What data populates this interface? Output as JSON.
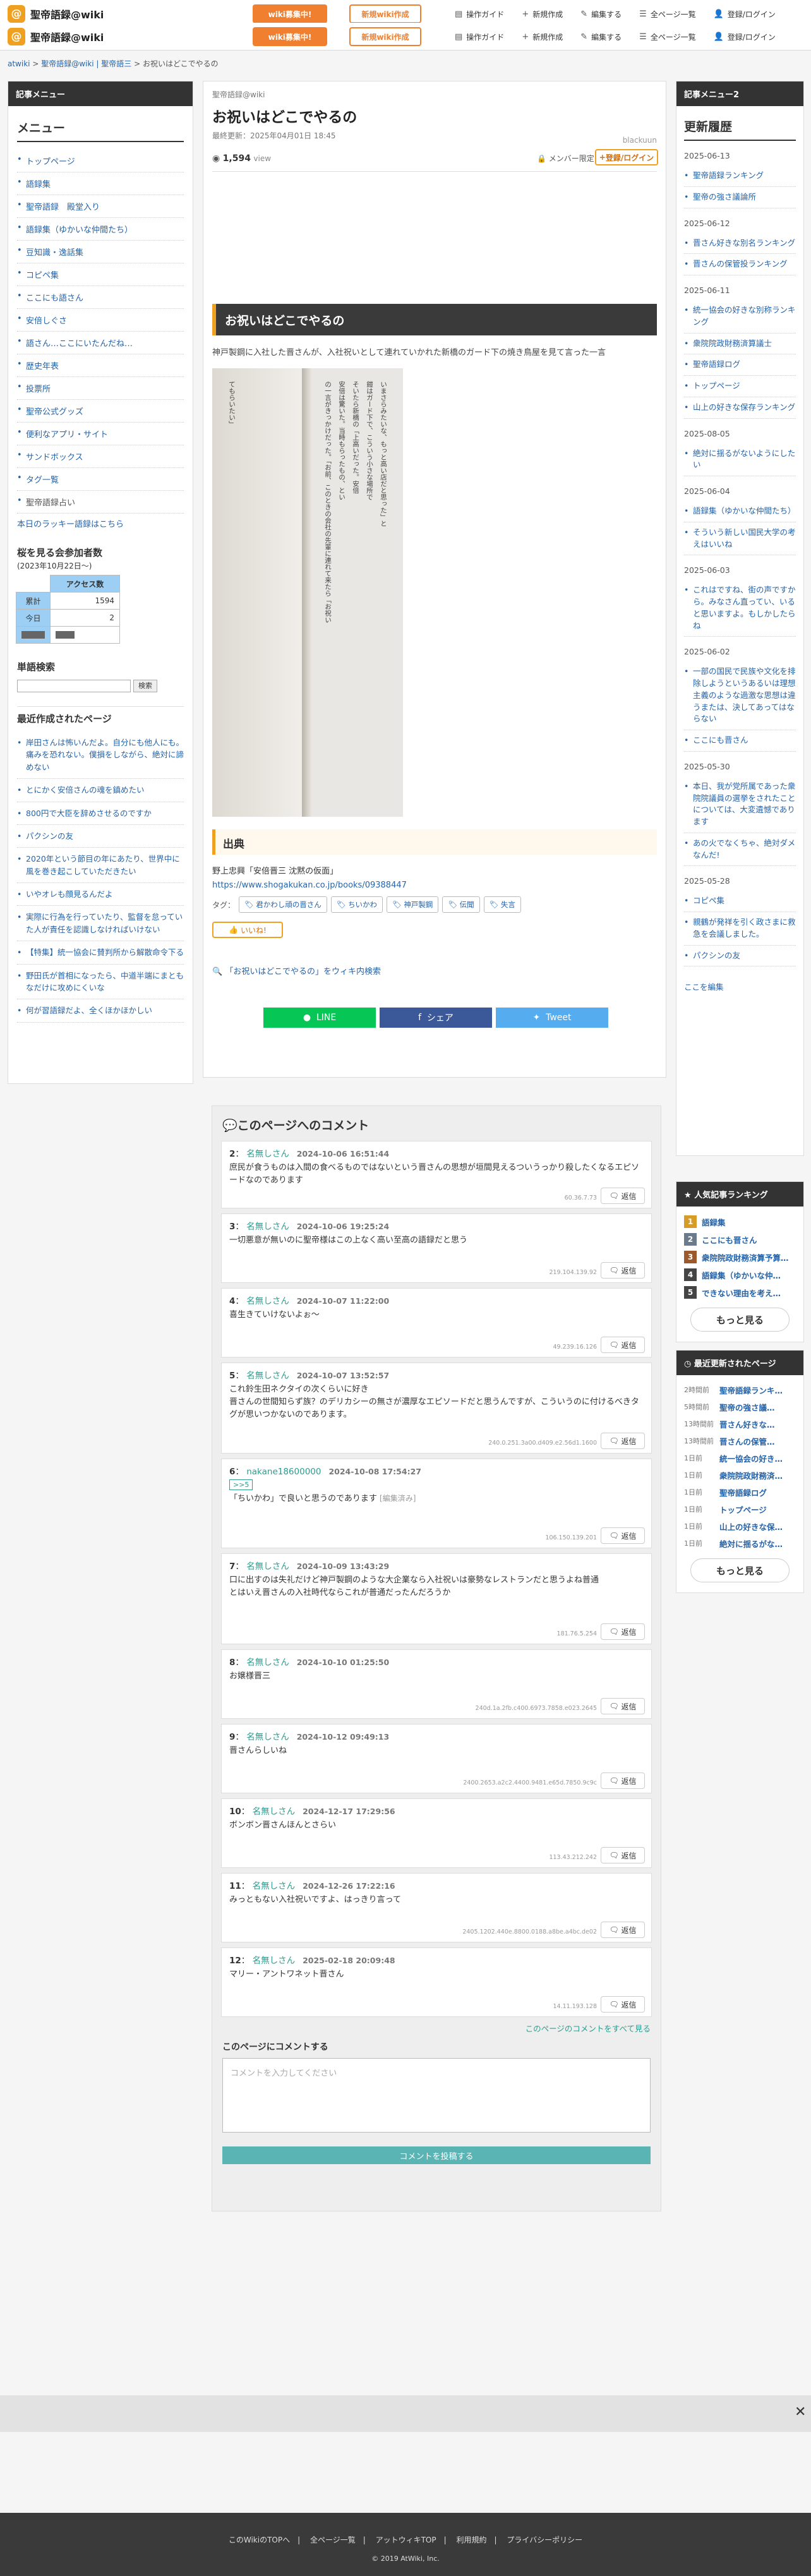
{
  "header": {
    "site_title": "聖帝語録@wiki",
    "logo_glyph": "@",
    "recruit": "wiki募集中!",
    "new_wiki": "新規wiki作成",
    "nav": [
      "操作ガイド",
      "新規作成",
      "編集する",
      "全ページ一覧",
      "登録/ログイン"
    ]
  },
  "breadcrumb": {
    "home": "atwiki",
    "site": "聖帝語録@wiki | 聖帝語三",
    "current": "お祝いはどこでやるの"
  },
  "left": {
    "header": "記事メニュー",
    "menu_title": "メニュー",
    "menu": [
      "トップページ",
      "語録集",
      "聖帝語録　殿堂入り",
      "語録集（ゆかいな仲間たち）",
      "豆知識・逸話集",
      "コピペ集",
      "ここにも語さん",
      "安倍しぐさ",
      "語さん…ここにいたんだね…",
      "歴史年表",
      "投票所",
      "聖帝公式グッズ",
      "便利なアプリ・サイト",
      "サンドボックス",
      "タグ一覧",
      "聖帝語録占い"
    ],
    "lucky": "本日のラッキー語録はこちら",
    "counter_title": "桜を見る会参加者数",
    "counter_sub": "(2023年10月22日〜)",
    "counter_head": "アクセス数",
    "counter": [
      {
        "k": "累計",
        "v": "1594"
      },
      {
        "k": "今日",
        "v": "2"
      }
    ],
    "search_title": "単語検索",
    "search_btn": "検索",
    "recent_title": "最近作成されたページ",
    "recent": [
      "岸田さんは怖いんだよ。自分にも他人にも。痛みを恐れない。僕損をしながら、絶対に諦めない",
      "とにかく安倍さんの魂を鎮めたい",
      "800円で大臣を辞めさせるのですか",
      "パクシンの友",
      "2020年という節目の年にあたり、世界中に風を巻き起こしていただきたい",
      "いやオレも顔見るんだよ",
      "実際に行為を行っていたり、監督を怠っていた人が責任を認識しなければいけない",
      "【特集】統一協会に賛判所から解散命令下る",
      "野田氏が首相になったら、中道半端にまともなだけに攻めにくいな",
      "何が習語録だよ、全くほかほかしい"
    ]
  },
  "article": {
    "site": "聖帝語録@wiki",
    "title": "お祝いはどこでやるの",
    "updated": "最終更新：2025年04月01日 18:45",
    "author": "blackuun",
    "views": "1,594",
    "views_unit": "view",
    "member": "メンバー限定",
    "login": "登録/ログイン",
    "h2": "お祝いはどこでやるの",
    "lead": "神戸製鋼に入社した晋さんが、入社祝いとして連れていかれた新橋のガード下の焼き鳥屋を見て言った一言",
    "photo_text": [
      "てもらいたい」",
      "の一言がきっかけだった。「お前、このときの会社の先輩に連れて来たら「お祝い",
      "安倍は驚いた。当時もらったもの、とい",
      "そいたら新橋の「上高いだった。安倍",
      "鎧はガード下で、こういう小さな場所で",
      "いまさらみたいな、もっと高い店だと思った」と"
    ],
    "source_h": "出典",
    "source_text": "野上忠興「安倍晋三 沈黙の仮面」",
    "source_url": "https://www.shogakukan.co.jp/books/09388447",
    "tags_label": "タグ：",
    "tags": [
      "君かわし頑の晋さん",
      "ちいかわ",
      "神戸製鋼",
      "伝聞",
      "失言"
    ],
    "like": "いいね!",
    "find": "「お祝いはどこでやるの」をウィキ内検索",
    "share": [
      "LINE",
      "シェア",
      "Tweet"
    ]
  },
  "comments": {
    "title": "このページへのコメント",
    "items": [
      {
        "no": "2",
        "name": "名無しさん",
        "date": "2024-10-06 16:51:44",
        "text": "庶民が食うものは入間の食べるものではないという晋さんの思想が垣間見えるついうっかり殺したくなるエピソードなのであります",
        "ip": "60.36.7.73"
      },
      {
        "no": "3",
        "name": "名無しさん",
        "date": "2024-10-06 19:25:24",
        "text": "一切悪意が無いのに聖帝様はこの上なく高い至高の語録だと思う",
        "ip": "219.104.139.92"
      },
      {
        "no": "4",
        "name": "名無しさん",
        "date": "2024-10-07 11:22:00",
        "text": "喜生きていけないよぉ〜",
        "ip": "49.239.16.126"
      },
      {
        "no": "5",
        "name": "名無しさん",
        "date": "2024-10-07 13:52:57",
        "text": "これ鈴生田ネクタイの次くらいに好き\n晋さんの世間知らず族？のデリカシーの無さが濃厚なエピソードだと思うんですが、こういうのに付けるべきタグが思いつかないのであります。",
        "ip": "240.0.251.3a00.d409.e2.56d1.1600"
      },
      {
        "no": "6",
        "name": "nakane18600000",
        "date": "2024-10-08 17:54:27",
        "text": "「ちいかわ」で良いと思うのであります",
        "edited": "[編集済み]",
        "reply": ">>5",
        "ip": "106.150.139.201"
      },
      {
        "no": "7",
        "name": "名無しさん",
        "date": "2024-10-09 13:43:29",
        "text": "口に出すのは失礼だけど神戸製鋼のような大企業なら入社祝いは豪勢なレストランだと思うよね普通\nとはいえ晋さんの入社時代ならこれが普通だったんだろうか",
        "ip": "181.76.5.254"
      },
      {
        "no": "8",
        "name": "名無しさん",
        "date": "2024-10-10 01:25:50",
        "text": "お嬢様晋三",
        "ip": "240d.1a.2fb.c400.6973.7858.e023.2645"
      },
      {
        "no": "9",
        "name": "名無しさん",
        "date": "2024-10-12 09:49:13",
        "text": "晋さんらしいね",
        "ip": "2400.2653.a2c2.4400.9481.e65d.7850.9c9c"
      },
      {
        "no": "10",
        "name": "名無しさん",
        "date": "2024-12-17 17:29:56",
        "text": "ボンボン晋さんほんとさらい",
        "ip": "113.43.212.242"
      },
      {
        "no": "11",
        "name": "名無しさん",
        "date": "2024-12-26 17:22:16",
        "text": "みっともない入社祝いですよ、はっきり言って",
        "ip": "2405.1202.440e.8800.0188.a8be.a4bc.de02"
      },
      {
        "no": "12",
        "name": "名無しさん",
        "date": "2025-02-18 20:09:48",
        "text": "マリー・アントワネット晋さん",
        "ip": "14.11.193.128"
      }
    ],
    "reply_label": "返信",
    "all": "このページのコメントをすべて見る",
    "form_label": "このページにコメントする",
    "placeholder": "コメントを入力してください",
    "post": "コメントを投稿する"
  },
  "right": {
    "header": "記事メニュー2",
    "title": "更新履歴",
    "history": [
      {
        "date": "2025-06-13",
        "items": [
          "聖帝語録ランキング",
          "聖帝の強さ議論所"
        ]
      },
      {
        "date": "2025-06-12",
        "items": [
          "晋さん好きな別名ランキング",
          "晋さんの保管投ランキング"
        ]
      },
      {
        "date": "2025-06-11",
        "items": [
          "統一協会の好きな別称ランキング",
          "衆院院政財務済算議士",
          "聖帝語録ログ",
          "トップページ",
          "山上の好きな保存ランキング"
        ]
      },
      {
        "date": "2025-08-05",
        "items": [
          "絶対に揺るがないようにしたい"
        ]
      },
      {
        "date": "2025-06-04",
        "items": [
          "語録集（ゆかいな仲間たち）",
          "そういう新しい国民大学の考えはいいね"
        ]
      },
      {
        "date": "2025-06-03",
        "items": [
          "これはですね、街の声ですから。みなさん直ってい、いると思いますよ。もしかしたらね"
        ]
      },
      {
        "date": "2025-06-02",
        "items": [
          "一部の国民で民族や文化を排除しようというあるいは理想主義のような過激な思想は違うまたは、決してあってはならない",
          "ここにも晋さん"
        ]
      },
      {
        "date": "2025-05-30",
        "items": [
          "本日、我が党所属であった衆院院議員の選挙をされたことについては、大変遺憾であります",
          "あの火でなくちゃ、絶対ダメなんだ!"
        ]
      },
      {
        "date": "2025-05-28",
        "items": [
          "コピペ集",
          "親鶴が発祥を引く政さまに救急を会議しました。",
          "パクシンの友"
        ]
      }
    ],
    "edit": "ここを編集",
    "rank_title": "人気記事ランキング",
    "rank": [
      "語録集",
      "ここにも晋さん",
      "衆院院政財務済算予算…",
      "語録集（ゆかいな仲…",
      "できない理由を考え…"
    ],
    "rank_colors": [
      "#d79b28",
      "#6b7b8c",
      "#9a5a2e",
      "#444444",
      "#444444"
    ],
    "more": "もっと見る",
    "recent_title": "最近更新されたページ",
    "recent": [
      {
        "t": "2時間前",
        "p": "聖帝語録ランキ…"
      },
      {
        "t": "5時間前",
        "p": "聖帝の強さ議…"
      },
      {
        "t": "13時間前",
        "p": "晋さん好きな…"
      },
      {
        "t": "13時間前",
        "p": "晋さんの保管…"
      },
      {
        "t": "1日前",
        "p": "統一協会の好き…"
      },
      {
        "t": "1日前",
        "p": "衆院院政財務済…"
      },
      {
        "t": "1日前",
        "p": "聖帝語録ログ"
      },
      {
        "t": "1日前",
        "p": "トップページ"
      },
      {
        "t": "1日前",
        "p": "山上の好きな保…"
      },
      {
        "t": "1日前",
        "p": "絶対に揺るがな…"
      }
    ]
  },
  "footer": {
    "links": [
      "このWikiのTOPへ",
      "全ページ一覧",
      "アットウィキTOP",
      "利用規約",
      "プライバシーポリシー"
    ],
    "copy": "2019 AtWiki, Inc."
  },
  "colors": {
    "accent": "#f0a020",
    "line": "#06c755",
    "facebook": "#3b5998",
    "twitter": "#55acee"
  }
}
